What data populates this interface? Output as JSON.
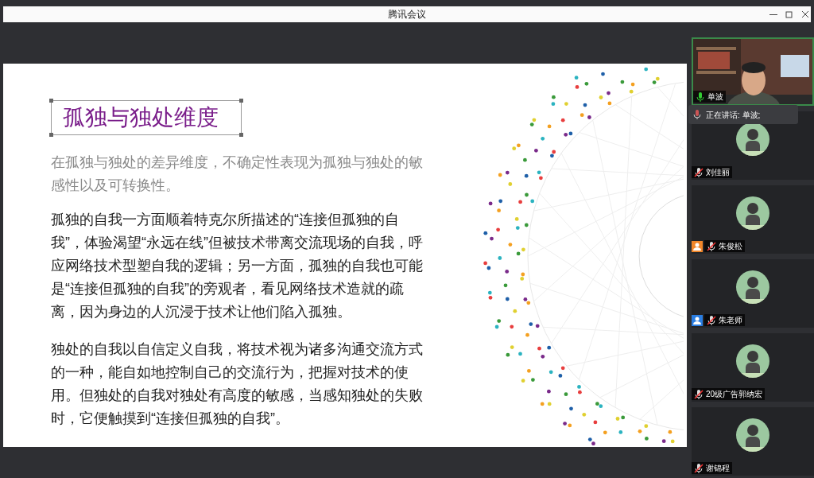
{
  "window": {
    "title": "腾讯会议"
  },
  "slide": {
    "title": "孤独与独处维度",
    "subtitle": "在孤独与独处的差异维度，不确定性表现为孤独与独处的敏感性以及可转换性。",
    "paragraphs": [
      "孤独的自我一方面顺着特克尔所描述的“连接但孤独的自我”，体验渴望“永远在线”但被技术带离交流现场的自我，呼应网络技术型塑自我的逻辑；另一方面，孤独的自我也可能是“连接但孤独的自我”的旁观者，看见网络技术造就的疏离，因为身边的人沉浸于技术让他们陷入孤独。",
      "独处的自我以自信定义自我，将技术视为诸多沟通交流方式的一种，能自如地控制自己的交流行为，把握对技术的使用。但独处的自我对独处有高度的敏感，当感知独处的失败时，它便触摸到“连接但孤独的自我”。"
    ]
  },
  "speaking_banner": "正在讲话: 单波;",
  "participants": [
    {
      "name": "单波",
      "kind": "video",
      "muted": false
    },
    {
      "name": "刘佳丽",
      "kind": "avatar",
      "muted": true
    },
    {
      "name": "朱俊松",
      "kind": "avatar",
      "muted": true,
      "color": "#f0862a"
    },
    {
      "name": "朱老师",
      "kind": "avatar",
      "muted": true,
      "color": "#2a7de1"
    },
    {
      "name": "20级广告郭纳宏",
      "kind": "avatar",
      "muted": true
    },
    {
      "name": "谢锦程",
      "kind": "avatar",
      "muted": true
    }
  ]
}
